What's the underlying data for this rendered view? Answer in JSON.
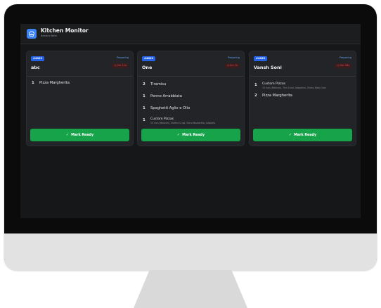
{
  "app": {
    "title": "Kitchen Monitor",
    "subtitle": "Bandra West"
  },
  "labels": {
    "mark_ready": "Mark Ready"
  },
  "colors": {
    "accent": "#3b82f6",
    "ready": "#16a34a",
    "status": "#60a5fa",
    "timer": "#ef4444"
  },
  "orders": [
    {
      "id": "#4029",
      "status": "Preparing",
      "customer": "abc",
      "timer": "0m 11s",
      "items": [
        {
          "qty": "1",
          "name": "Pizza Margherita",
          "desc": ""
        }
      ]
    },
    {
      "id": "#4022",
      "status": "Preparing",
      "customer": "One",
      "timer": "0m 7s",
      "items": [
        {
          "qty": "2",
          "name": "Tiramisu",
          "desc": ""
        },
        {
          "qty": "1",
          "name": "Penne Arrabbiata",
          "desc": ""
        },
        {
          "qty": "1",
          "name": "Spaghetti Aglio e Olio",
          "desc": ""
        },
        {
          "qty": "1",
          "name": "Custom Pizzas",
          "desc": "10 inch (Medium), Stuffed Crust, Extra Mozzarella, Jalapeño"
        }
      ]
    },
    {
      "id": "#4025",
      "status": "Preparing",
      "customer": "Vansh Soni",
      "timer": "0m 38s",
      "items": [
        {
          "qty": "1",
          "name": "Custom Pizzas",
          "desc": "10 inch (Medium), Thin Crust, Jalapeños, Olives, Baby Corn"
        },
        {
          "qty": "2",
          "name": "Pizza Margherita",
          "desc": ""
        }
      ]
    }
  ]
}
